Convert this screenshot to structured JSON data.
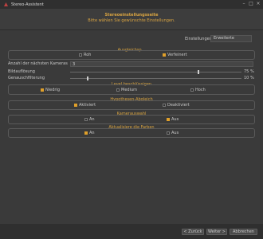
{
  "window": {
    "title": "Stereo-Assistent"
  },
  "header": {
    "title": "Stereoeinstellungsseite",
    "subtitle": "Bitte wählen Sie gewünschte Einstellungen."
  },
  "settings": {
    "label": "Einstellungen :",
    "value": "Erweiterte"
  },
  "arrangement": {
    "title": "Ausgleichsp...",
    "options": [
      "Roh",
      "Verfeinert"
    ],
    "selected": 1
  },
  "cameras": {
    "label": "Anzahl der nächsten Kameras",
    "value": "3"
  },
  "resolution": {
    "label": "Bildauflösung",
    "value_text": "75 %",
    "value": 75
  },
  "filter": {
    "label": "Genauschfilterung",
    "value_text": "10 %",
    "value": 10
  },
  "level": {
    "title": "Level beschlüssigen",
    "options": [
      "Niedrig",
      "Medium",
      "Hoch"
    ],
    "selected": 0
  },
  "hypothesis": {
    "title": "Hypothesen-Abgleich",
    "options": [
      "Aktiviert",
      "Deaktiviert"
    ],
    "selected": 0
  },
  "camera_filter": {
    "title": "Kamerauswahl",
    "options": [
      "An",
      "Aus"
    ],
    "selected": 1
  },
  "colors": {
    "title": "Aktualisiere die Farben",
    "options": [
      "An",
      "Aus"
    ],
    "selected": 0
  },
  "footer": {
    "back": "< Zurück",
    "next": "Weiter >",
    "cancel": "Abbrechen"
  },
  "accent_color": "#d9a441"
}
